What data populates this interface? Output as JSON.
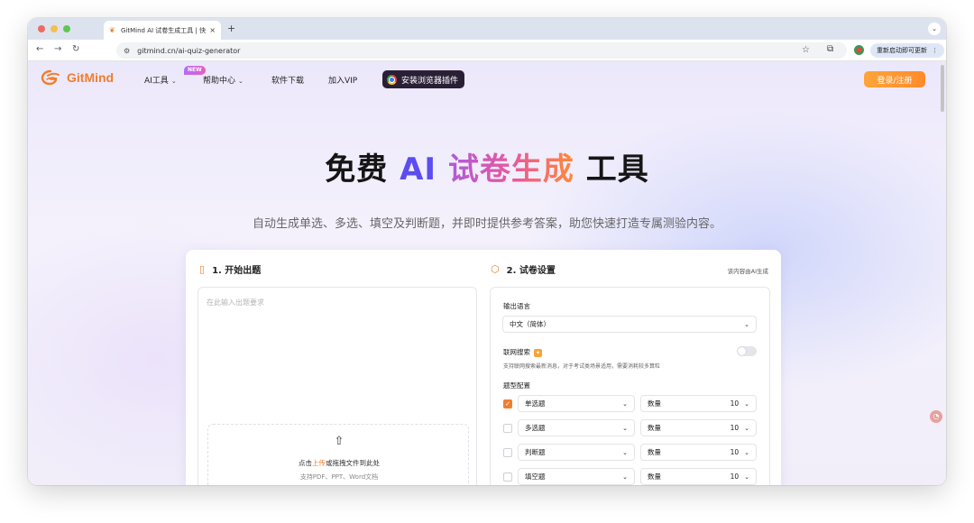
{
  "browser": {
    "tab_title": "GitMind AI 试卷生成工具 | 快速",
    "tab_close": "×",
    "new_tab": "+",
    "url": "gitmind.cn/ai-quiz-generator",
    "update_button": "重新启动即可更新",
    "update_dots": "⋮",
    "tab_menu": "⌄",
    "traffic_colors": [
      "#ee6a5f",
      "#f5be4f",
      "#61c554"
    ]
  },
  "nav": {
    "logo_text": "GitMind",
    "items": [
      {
        "label": "AI工具"
      },
      {
        "label": "帮助中心"
      },
      {
        "label": "软件下载"
      },
      {
        "label": "加入VIP"
      }
    ],
    "new_badge": "NEW",
    "plugin_button": "安装浏览器插件",
    "login_button": "登录/注册"
  },
  "hero": {
    "title_part1": "免费 ",
    "title_ai": "AI",
    "title_grad": " 试卷生成",
    "title_part2": " 工具",
    "subtitle": "自动生成单选、多选、填空及判断题，并即时提供参考答案，助您快速打造专属测验内容。"
  },
  "step1": {
    "title": "1. 开始出题",
    "placeholder": "在此输入出题要求",
    "upload_prefix": "点击",
    "upload_link": "上传",
    "upload_suffix": "或拖拽文件到此处",
    "upload_hint": "支持PDF、PPT、Word文档"
  },
  "step2": {
    "title": "2. 试卷设置",
    "ai_note": "该内容由AI生成",
    "language_label": "输出语言",
    "language_value": "中文（简体）",
    "web_search_label": "联网搜索",
    "web_search_enabled": false,
    "web_search_hint": "支持联网搜索最新消息，对于考试类场景适用，需要消耗较多算粒",
    "types_label": "题型配置",
    "count_label": "数量",
    "types": [
      {
        "name": "单选题",
        "checked": true,
        "count": "10"
      },
      {
        "name": "多选题",
        "checked": false,
        "count": "10"
      },
      {
        "name": "判断题",
        "checked": false,
        "count": "10"
      },
      {
        "name": "填空题",
        "checked": false,
        "count": "10"
      }
    ]
  },
  "colors": {
    "brand_orange": "#f07e2e",
    "ai_blue": "#5b4df0"
  }
}
